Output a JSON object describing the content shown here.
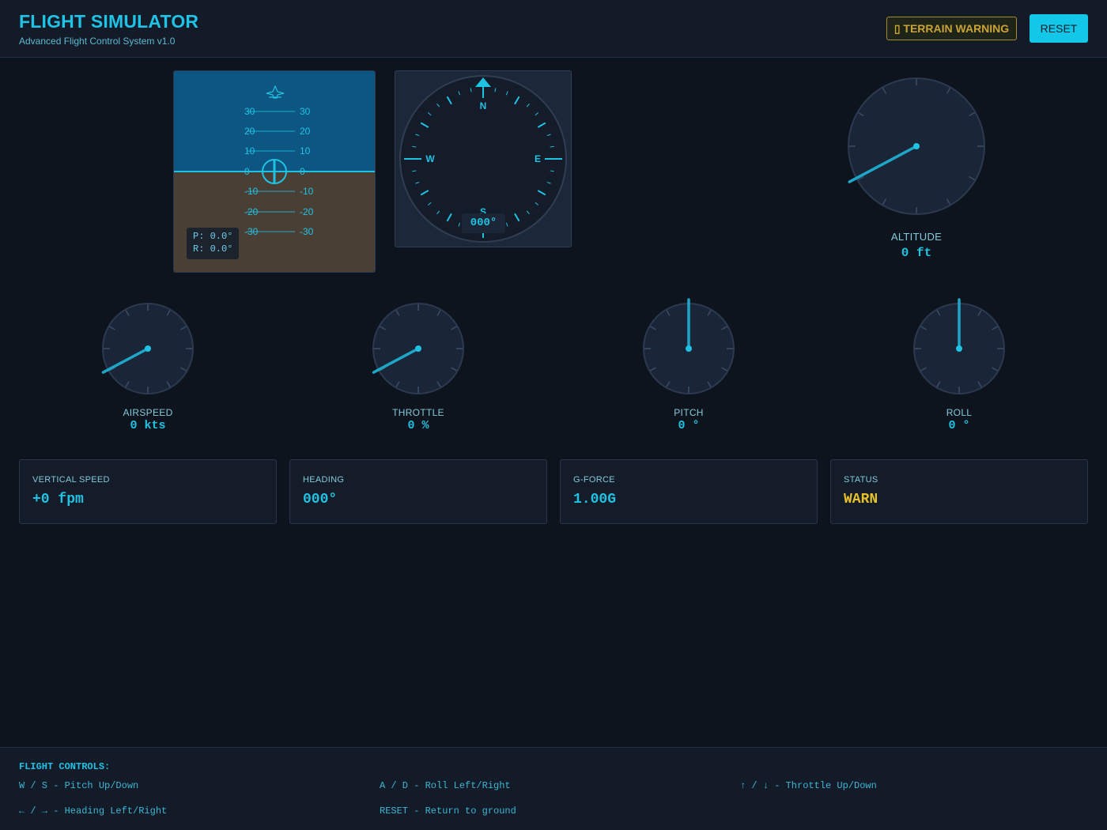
{
  "header": {
    "title": "FLIGHT SIMULATOR",
    "subtitle": "Advanced Flight Control System v1.0",
    "warning_label": "▯ TERRAIN WARNING",
    "reset_label": "RESET"
  },
  "attitude": {
    "pitch_lines": [
      {
        "left": "30",
        "right": "30"
      },
      {
        "left": "20",
        "right": "20"
      },
      {
        "left": "10",
        "right": "10"
      },
      {
        "left": "0",
        "right": "0"
      },
      {
        "left": "-10",
        "right": "-10"
      },
      {
        "left": "-20",
        "right": "-20"
      },
      {
        "left": "-30",
        "right": "-30"
      }
    ],
    "pitch_readout": "P: 0.0°",
    "roll_readout": "R: 0.0°"
  },
  "compass": {
    "cardinals": {
      "n": "N",
      "e": "E",
      "s": "S",
      "w": "W"
    },
    "readout": "000°"
  },
  "altitude": {
    "label": "ALTITUDE",
    "value": "0 ft"
  },
  "gauges": [
    {
      "label": "AIRSPEED",
      "value": "0 kts"
    },
    {
      "label": "THROTTLE",
      "value": "0 %"
    },
    {
      "label": "PITCH",
      "value": "0 °"
    },
    {
      "label": "ROLL",
      "value": "0 °"
    }
  ],
  "stats": [
    {
      "label": "VERTICAL SPEED",
      "value": "+0 fpm"
    },
    {
      "label": "HEADING",
      "value": "000°"
    },
    {
      "label": "G-FORCE",
      "value": "1.00G"
    },
    {
      "label": "STATUS",
      "value": "WARN"
    }
  ],
  "footer": {
    "title": "FLIGHT CONTROLS:",
    "controls": [
      "W / S - Pitch Up/Down",
      "A / D - Roll Left/Right",
      "↑ / ↓ - Throttle Up/Down",
      "← / → - Heading Left/Right",
      "RESET - Return to ground"
    ]
  },
  "colors": {
    "accent": "#20c2e4",
    "warning": "#e6c12a",
    "sky": "#0d5681",
    "ground": "#4a3f35"
  }
}
